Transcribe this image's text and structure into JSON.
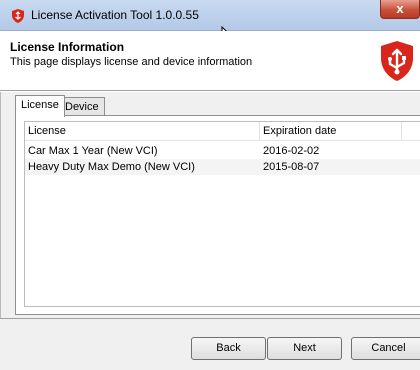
{
  "window": {
    "title": "License Activation Tool 1.0.0.55",
    "close_label": "x"
  },
  "header": {
    "title": "License Information",
    "subtitle": "This page displays license and device information"
  },
  "tabs": [
    {
      "label": "License",
      "active": true
    },
    {
      "label": "Device",
      "active": false
    }
  ],
  "list": {
    "columns": [
      "License",
      "Expiration date"
    ],
    "rows": [
      [
        "Car Max 1 Year (New VCI)",
        "2016-02-02"
      ],
      [
        "Heavy Duty Max Demo (New VCI)",
        "2015-08-07"
      ]
    ]
  },
  "buttons": {
    "back": "Back",
    "next": "Next",
    "cancel": "Cancel"
  },
  "colors": {
    "brand_red": "#d9261c",
    "titlebar": "#bfd3ee"
  }
}
